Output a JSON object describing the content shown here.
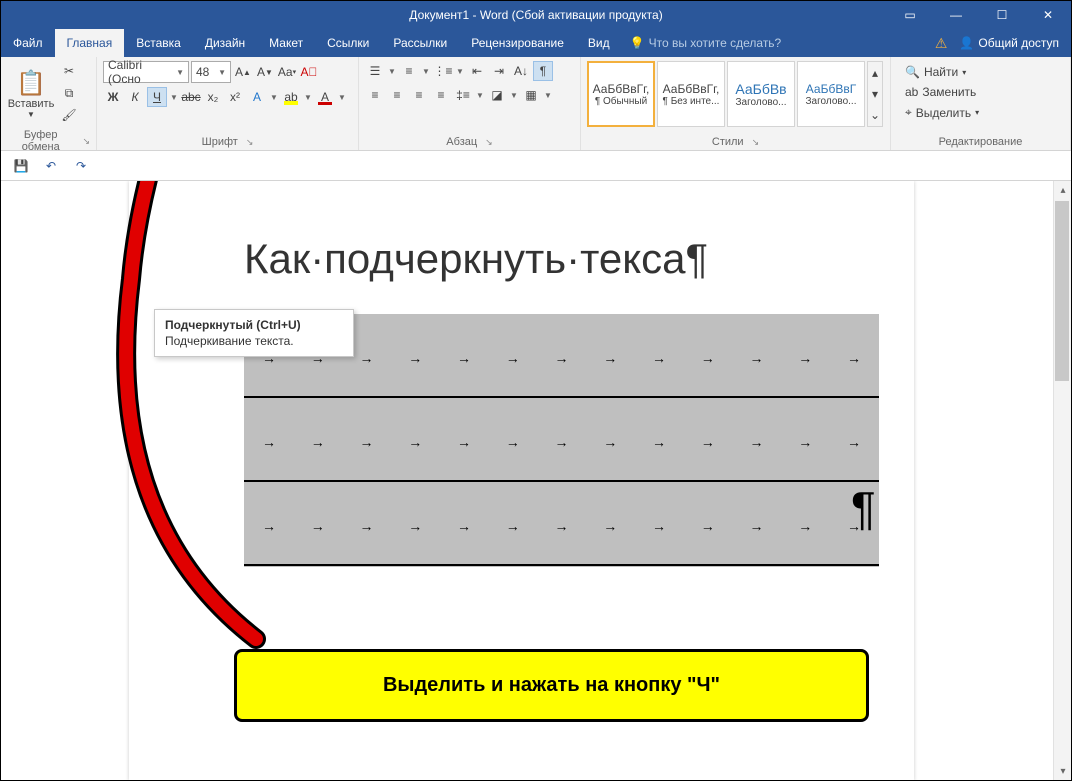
{
  "titlebar": {
    "title": "Документ1 - Word (Сбой активации продукта)"
  },
  "menu": {
    "file": "Файл",
    "home": "Главная",
    "insert": "Вставка",
    "design": "Дизайн",
    "layout": "Макет",
    "references": "Ссылки",
    "mailings": "Рассылки",
    "review": "Рецензирование",
    "view": "Вид",
    "tellme": "Что вы хотите сделать?",
    "share": "Общий доступ"
  },
  "ribbon": {
    "clipboard": {
      "paste": "Вставить",
      "label": "Буфер обмена"
    },
    "font": {
      "name": "Calibri (Осно",
      "size": "48",
      "bold": "Ж",
      "italic": "К",
      "underline": "Ч",
      "label": "Шрифт"
    },
    "paragraph": {
      "label": "Абзац"
    },
    "styles": {
      "label": "Стили",
      "items": [
        {
          "preview": "АаБбВвГг,",
          "name": "¶ Обычный"
        },
        {
          "preview": "АаБбВвГг,",
          "name": "¶ Без инте..."
        },
        {
          "preview": "АаБбВв",
          "name": "Заголово..."
        },
        {
          "preview": "АаБбВвГ",
          "name": "Заголово..."
        }
      ]
    },
    "editing": {
      "find": "Найти",
      "replace": "Заменить",
      "select": "Выделить",
      "label": "Редактирование"
    }
  },
  "tooltip": {
    "title": "Подчеркнутый (Ctrl+U)",
    "desc": "Подчеркивание текста."
  },
  "document": {
    "heading": "Как·подчеркнуть·текса¶",
    "pilcrow": "¶"
  },
  "callout": {
    "text": "Выделить и нажать на кнопку \"Ч\""
  }
}
